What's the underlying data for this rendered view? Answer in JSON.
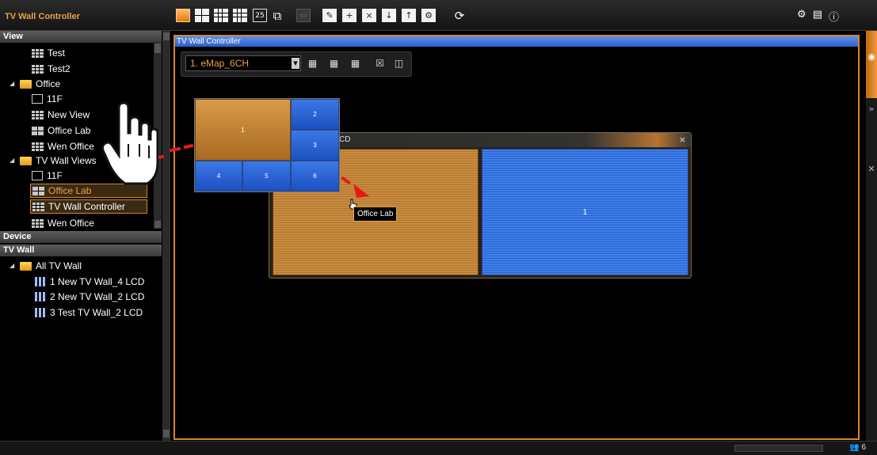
{
  "app": {
    "title": "TV Wall Controller"
  },
  "toolbar": {
    "layout_25_label": "25"
  },
  "left_panel": {
    "view_header": "View",
    "view_items": [
      {
        "label": "Test",
        "icon": "grid-icon"
      },
      {
        "label": "Test2",
        "icon": "grid-icon"
      },
      {
        "label": "Office",
        "icon": "folder-icon"
      },
      {
        "label": "11F",
        "icon": "emap-icon"
      },
      {
        "label": "New View",
        "icon": "grid-icon"
      },
      {
        "label": "Office Lab",
        "icon": "grid4-icon"
      },
      {
        "label": "Wen Office",
        "icon": "grid-icon"
      },
      {
        "label": "TV Wall Views",
        "icon": "folder-icon"
      },
      {
        "label": "11F",
        "icon": "emap-icon"
      },
      {
        "label": "Office Lab",
        "icon": "grid4-icon"
      },
      {
        "label": "TV Wall Controller",
        "icon": "grid-icon"
      },
      {
        "label": "Wen Office",
        "icon": "grid-icon"
      }
    ],
    "device_header": "Device",
    "tvwall_header": "TV Wall",
    "tvwall_items": [
      {
        "label": "All TV Wall",
        "icon": "folder-icon"
      },
      {
        "label": "1 New TV Wall_4 LCD",
        "icon": "tv-wall-icon"
      },
      {
        "label": "2 New TV Wall_2 LCD",
        "icon": "tv-wall-icon"
      },
      {
        "label": "3 Test TV Wall_2 LCD",
        "icon": "tv-wall-icon"
      }
    ]
  },
  "main": {
    "title": "TV Wall Controller",
    "map_select": "1. eMap_6CH",
    "layout_popup": {
      "cells": [
        "1",
        "2",
        "3",
        "4",
        "5",
        "6"
      ]
    },
    "lcd_window": {
      "title": "CD",
      "close": "×",
      "right_label": "1"
    },
    "tooltip": "Office Lab"
  },
  "status": {
    "user_count": "6"
  },
  "colors": {
    "accent_orange": "#e8a24a",
    "selection_blue": "#2e5fc9",
    "arrow_red": "#e41a1a"
  }
}
